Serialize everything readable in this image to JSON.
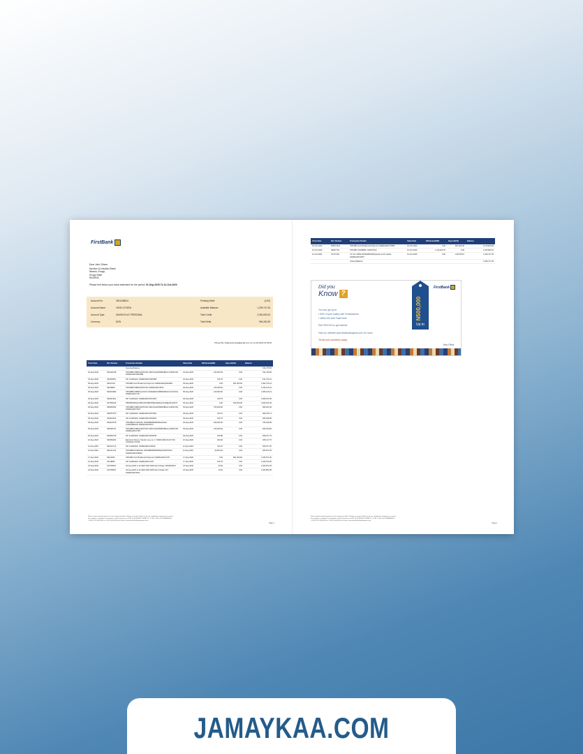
{
  "bank": {
    "name": "FirstBank"
  },
  "customer": {
    "salutation": "Dear John Citizen",
    "address_lines": [
      "Number 6,Umuafia Street,",
      "Nkwolo, Enugu,",
      "Enugu State",
      "NIGERIA"
    ]
  },
  "intro": {
    "prefix": "Please find below your bank statement for the period: ",
    "period": "01-Sep-2020 To 11-Oct-2020"
  },
  "account": {
    "left": [
      {
        "label": "Account No:",
        "value": "3001228634"
      },
      {
        "label": "Account Name:",
        "value": "JOHN CITIZEN"
      },
      {
        "label": "Account Type:",
        "value": "SAVINGS A/C PERSONAL"
      },
      {
        "label": "Currency:",
        "value": "NGN"
      }
    ],
    "right": [
      {
        "label": "Pending Debit:",
        "value": "(0.00)"
      },
      {
        "label": "Available Balance:",
        "value": "1,299,747.36"
      },
      {
        "label": "Total Credit:",
        "value": "2,260,000.00"
      },
      {
        "label": "Total Debit:",
        "value": "964,262.69"
      }
    ]
  },
  "printed_by": "Printed By: bellamydonnelly@gmail.com on 11-Oct-2020 10:45:26",
  "table_headers": [
    "Trans Date",
    "Ref. Number",
    "Transaction Details",
    "Value Date",
    "Withdrawal(DR)",
    "Deposit(CR)",
    "Balance"
  ],
  "page1_rows": [
    {
      "date": "",
      "ref": "",
      "details": "Opening Balance",
      "value_date": "",
      "dr": "",
      "cr": "",
      "bal": "614,475.96"
    },
    {
      "date": "04-Sep-2020",
      "ref": "S94120448",
      "details": "TRF/MB/FCMB/CHRISTIAN UMUOHA/FBNMOBILE:CHRISTIAN NARIEGWU/0045488",
      "value_date": "04-Sep-2020",
      "dr": "100,000.00",
      "cr": "0.00",
      "bal": "514,475.96"
    },
    {
      "date": "04-Sep-2020",
      "ref": "S94118051",
      "details": "FIP CHARGES: NARIEGWU/0045488",
      "value_date": "04-Sep-2020",
      "dr": "106.75",
      "cr": "0.00",
      "bal": "514,370.21"
    },
    {
      "date": "09-Sep-2020",
      "ref": "S9137024",
      "details": "TRF/MB Ozoh Bro/Emeritt Payment NARIEGWU/0043834",
      "value_date": "09-Sep-2020",
      "dr": "0.00",
      "cr": "867,000.00",
      "bal": "1,381,370.21"
    },
    {
      "date": "09-Sep-2020",
      "ref": "S9128822",
      "details": "TRF/MB/FCMB/CHRISTIAN /NARIEGWU/6973",
      "value_date": "09-Sep-2020",
      "dr": "215,250.00",
      "cr": "0.00",
      "bal": "1,166,120.21"
    },
    {
      "date": "09-Sep-2020",
      "ref": "S94313800",
      "details": "TRF/MB/FCMB/KALAGOS OFOEZE/FCMB/MOBILE:FULIUS/CH NARIEGWU/7117",
      "value_date": "09-Sep-2020",
      "dr": "100,000.00",
      "cr": "0.00",
      "bal": "1,066,120.21"
    },
    {
      "date": "09-Sep-2020",
      "ref": "S94311924",
      "details": "FIP CHARGES: NARIEGWU/0073225",
      "value_date": "09-Sep-2020",
      "dr": "106.75",
      "cr": "0.00",
      "bal": "1,066,013.46"
    },
    {
      "date": "09-Sep-2020",
      "ref": "S47350229",
      "details": "FBNM/MOBILE:GBIS ENTERPRISES/Mikhail NARIEGWU/0073",
      "value_date": "09-Sep-2020",
      "dr": "0.00",
      "cr": "600,250.00",
      "bal": "1,666,263.46"
    },
    {
      "date": "09-Sep-2020",
      "ref": "S96650534",
      "details": "TRF/MB/FCMB/CHRISTIAN UMUOHA/FBNMOBILE:CHRISTIAN NARIEGWU/7034",
      "value_date": "09-Sep-2020",
      "dr": "700,000.00",
      "cr": "0.00",
      "bal": "966,263.46"
    },
    {
      "date": "09-Sep-2020",
      "ref": "S96657570",
      "details": "FIP CHARGES: NARIEGWU/0073934",
      "value_date": "09-Sep-2020",
      "dr": "106.75",
      "cr": "0.00",
      "bal": "966,156.71"
    },
    {
      "date": "09-Sep-2020",
      "ref": "S94319232",
      "details": "FIP CHARGES: NARIEGWU/0004433",
      "value_date": "09-Sep-2020",
      "dr": "106.75",
      "cr": "0.00",
      "bal": "966,049.96"
    },
    {
      "date": "09-Sep-2020",
      "ref": "S94321578",
      "details": "TRF/MB/ACCESS/NL 1000/MB/FBNMOBILE/ALEX CHIZOMBA/CH NARIEGWU/0072",
      "value_date": "09-Sep-2020",
      "dr": "200,000.00",
      "cr": "0.00",
      "bal": "766,049.96"
    },
    {
      "date": "09-Sep-2020",
      "ref": "S90466731",
      "details": "TRF/MB/FCMB/CHRISTIAN UMUOHA/FBNMOBILE:CHRISTIAN NARIEGWU/7095",
      "value_date": "09-Sep-2020",
      "dr": "100,000.00",
      "cr": "0.00",
      "bal": "666,049.96"
    },
    {
      "date": "09-Sep-2020",
      "ref": "S90456739",
      "details": "FIP CHARGES: NARIEGWU/0003448",
      "value_date": "09-Sep-2020",
      "dr": "106.88",
      "cr": "0.00",
      "bal": "665,977.76"
    },
    {
      "date": "10-Sep-2020",
      "ref": "S90359234",
      "details": "Electronic Money Transfer Levy on 1 7,9905 FRM 09-09 TO/F TRANSACTIONS",
      "value_date": "10-Sep-2020",
      "dr": "300.00",
      "cr": "0.00",
      "bal": "665,117.76"
    },
    {
      "date": "11-Sep-2020",
      "ref": "S91210713",
      "details": "FIP CHARGES: NARIEGWU/016616",
      "value_date": "11-Sep-2020",
      "dr": "106.75",
      "cr": "0.00",
      "bal": "665,677.00"
    },
    {
      "date": "11-Sep-2020",
      "ref": "S91211724",
      "details": "TRF/MB/ACCESS/NL 1000/MB/FBNMOBILE/CHRISTIAN NARIEGWU/018916",
      "value_date": "11-Sep-2020",
      "dr": "60,000.00",
      "cr": "0.00",
      "bal": "605,571.00"
    },
    {
      "date": "17-Sep-2020",
      "ref": "S9112091",
      "details": "TRF/MB Ozoh Bro/Emeritt Payment NARIEGWU/3178",
      "value_date": "17-Sep-2020",
      "dr": "0.00",
      "cr": "801,000.00",
      "bal": "1,406,571.00"
    },
    {
      "date": "22-Sep-2020",
      "ref": "S2118881",
      "details": "FIP CHARGES: NARIEGWU/3178",
      "value_date": "17-Sep-2020",
      "dr": "106.75",
      "cr": "0.00",
      "bal": "1,406,416.25"
    },
    {
      "date": "23-Sep-2020",
      "ref": "S10709637",
      "details": "29-Aug-2020 to 22-SEP-2020 SMS Alert Charge 19/SMS/6011",
      "value_date": "23-Sep-2020",
      "dr": "44.00",
      "cr": "0.00",
      "bal": "1,300,872.25"
    },
    {
      "date": "23-Sep-2020",
      "ref": "S10709637",
      "details": "29-Aug-2020 to 22-SEP-2020 SMS Alert Charge VAT NARIEGWU/6011",
      "value_date": "23-Sep-2020",
      "dr": "10.20",
      "cr": "0.00",
      "bal": "1,300,862.05"
    }
  ],
  "page2_rows": [
    {
      "date": "04-Oct-2020",
      "ref": "S06071611",
      "details": "TRF/MB Ozoh Bro/Emeritt Payment NARIEGWU/74865",
      "value_date": "04-Oct-2020",
      "dr": "0.00",
      "cr": "867,000.00",
      "bal": "2,276,829.96"
    },
    {
      "date": "10-Oct-2020",
      "ref": "S9307740",
      "details": "TRF/MB: FCMB/MB: CHRISTIAN",
      "value_date": "10-Oct-2020",
      "dr": "1,116,000.75",
      "cr": "0.00",
      "bal": "1,150,829.21"
    },
    {
      "date": "11-Oct-2020",
      "ref": "S7477403",
      "details": "CT from GBIS ENTERPRISES/pieedy via Dr. Edwin NARIEGWU/0007",
      "value_date": "10-Oct-2020",
      "dr": "0.00",
      "cr": "219,978.15",
      "bal": "1,230,747.36"
    },
    {
      "date": "",
      "ref": "",
      "details": "Closing Balance",
      "value_date": "",
      "dr": "",
      "cr": "",
      "bal": "1,299,747.36"
    }
  ],
  "footer": {
    "lines": [
      "Please report any discrepancies in this statement within 15 days of receipt. Failure to do so is implied the statement as correct.",
      "For enquiries, complaints or feedback, call FirstContact on 0700 34 78 (FIRSTCONTACT) / 1-234 1 7015 0477768888/9000",
      "+234 (0) 700 900 0000 or +234 (0) 444 0000 or E-mail: firstcontact@firstbanknigeria.com"
    ],
    "page1": "Page 1",
    "page2": "Page 2"
  },
  "promo": {
    "line1": "Did you",
    "line2": "Know",
    "qmark": "?",
    "text1": "You can get up to",
    "text2": "• 50% of your salary with FirstAdvance",
    "text3": "• N500,000 with FastCredit",
    "text4": "Dial *894*11# to get started.",
    "text5": "Visit our website www.firstbanknigeria.com for more.",
    "terms": "Terms and conditions apply.",
    "amount": "N500,000",
    "upto": "Up to",
    "you_first": "You First"
  },
  "banner": {
    "text": "JAMAYKAA.COM"
  },
  "colors": {
    "header_bg": "#1f3f78",
    "account_bg": "#f8e7c6",
    "banner_text": "#245b89",
    "accent": "#d8a51d"
  }
}
